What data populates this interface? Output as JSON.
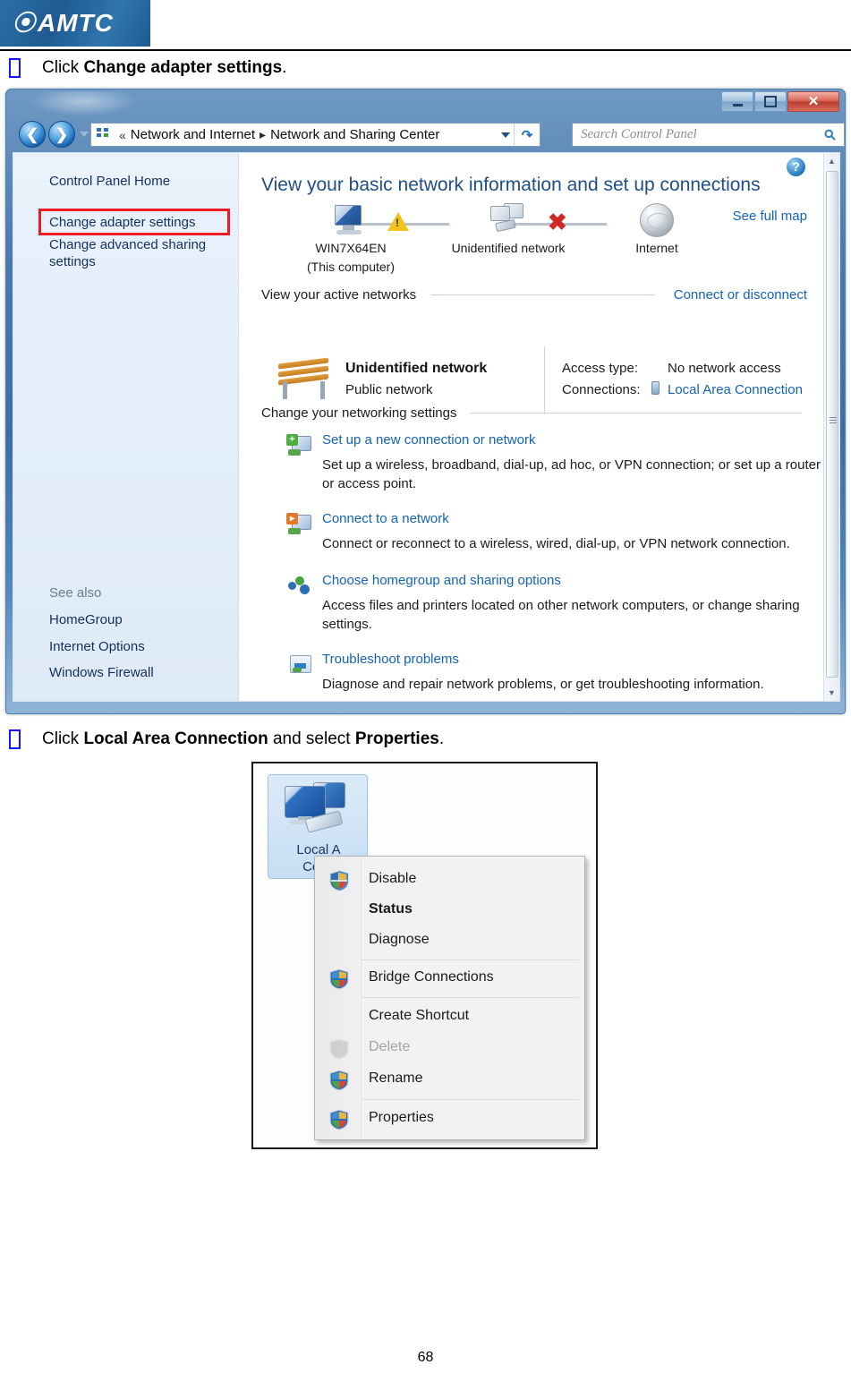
{
  "header": {
    "logo_text": "AMTC",
    "logo_mark": "swirl-logo-icon"
  },
  "steps": [
    {
      "prefix": "Click ",
      "bold": "Change adapter settings",
      "suffix": "."
    },
    {
      "prefix": "Click ",
      "bold": "Local Area Connection",
      "mid": " and select ",
      "bold2": "Properties",
      "suffix": "."
    }
  ],
  "window": {
    "controls": {
      "minimize": "Minimize",
      "maximize": "Maximize",
      "close": "Close"
    },
    "nav": {
      "back": "Back",
      "forward": "Forward",
      "recent_pages": "Recent Pages"
    },
    "address": {
      "icon": "network-sharing-icon",
      "overflow": "«",
      "crumbs": [
        "Network and Internet",
        "Network and Sharing Center"
      ],
      "separator": "▸",
      "dropdown": "Previous Locations",
      "refresh": "Refresh"
    },
    "search": {
      "placeholder": "Search Control Panel",
      "icon": "search-icon"
    },
    "help": "?"
  },
  "sidebar": {
    "items": [
      {
        "label": "Control Panel Home",
        "highlighted": false
      },
      {
        "label": "Change adapter settings",
        "highlighted": true
      },
      {
        "label": "Change advanced sharing settings",
        "highlighted": false
      }
    ],
    "see_also_heading": "See also",
    "see_also": [
      "HomeGroup",
      "Internet Options",
      "Windows Firewall"
    ]
  },
  "content": {
    "heading": "View your basic network information and set up connections",
    "see_full_map": "See full map",
    "map_nodes": [
      {
        "label": "WIN7X64EN",
        "sublabel": "(This computer)",
        "icon": "computer-icon"
      },
      {
        "label": "Unidentified network",
        "sublabel": "",
        "icon": "multiple-computers-icon"
      },
      {
        "label": "Internet",
        "sublabel": "",
        "icon": "globe-icon"
      }
    ],
    "map_link_status": [
      "warning-triangle-icon",
      "red-x-icon"
    ],
    "active_networks": {
      "heading": "View your active networks",
      "link": "Connect or disconnect",
      "network_name": "Unidentified network",
      "network_type": "Public network",
      "access_type_key": "Access type:",
      "access_type_value": "No network access",
      "connections_key": "Connections:",
      "connections_value": "Local Area Connection"
    },
    "networking_settings": {
      "heading": "Change your networking settings",
      "tasks": [
        {
          "icon": "new-connection-icon",
          "title": "Set up a new connection or network",
          "desc": "Set up a wireless, broadband, dial-up, ad hoc, or VPN connection; or set up a router or access point."
        },
        {
          "icon": "connect-network-icon",
          "title": "Connect to a network",
          "desc": "Connect or reconnect to a wireless, wired, dial-up, or VPN network connection."
        },
        {
          "icon": "homegroup-icon",
          "title": "Choose homegroup and sharing options",
          "desc": "Access files and printers located on other network computers, or change sharing settings."
        },
        {
          "icon": "troubleshoot-icon",
          "title": "Troubleshoot problems",
          "desc": "Diagnose and repair network problems, or get troubleshooting information."
        }
      ]
    }
  },
  "shot2": {
    "tile": {
      "icon": "local-area-connection-icon",
      "label": "Local A\nConn"
    },
    "context_menu": [
      {
        "label": "Disable",
        "shield": true,
        "bold": false,
        "disabled": false
      },
      {
        "label": "Status",
        "shield": false,
        "bold": true,
        "disabled": false
      },
      {
        "label": "Diagnose",
        "shield": false,
        "bold": false,
        "disabled": false
      },
      {
        "label": "Bridge Connections",
        "shield": true,
        "bold": false,
        "disabled": false
      },
      {
        "label": "Create Shortcut",
        "shield": false,
        "bold": false,
        "disabled": false
      },
      {
        "label": "Delete",
        "shield": true,
        "bold": false,
        "disabled": true
      },
      {
        "label": "Rename",
        "shield": true,
        "bold": false,
        "disabled": false
      },
      {
        "label": "Properties",
        "shield": true,
        "bold": false,
        "disabled": false
      }
    ]
  },
  "footer": {
    "page_number": "68"
  },
  "colors": {
    "accent_blue": "#1363b4",
    "highlight_red": "#ec1c24",
    "logo_blue": "#245e96",
    "heading_blue": "#1f4e87"
  }
}
